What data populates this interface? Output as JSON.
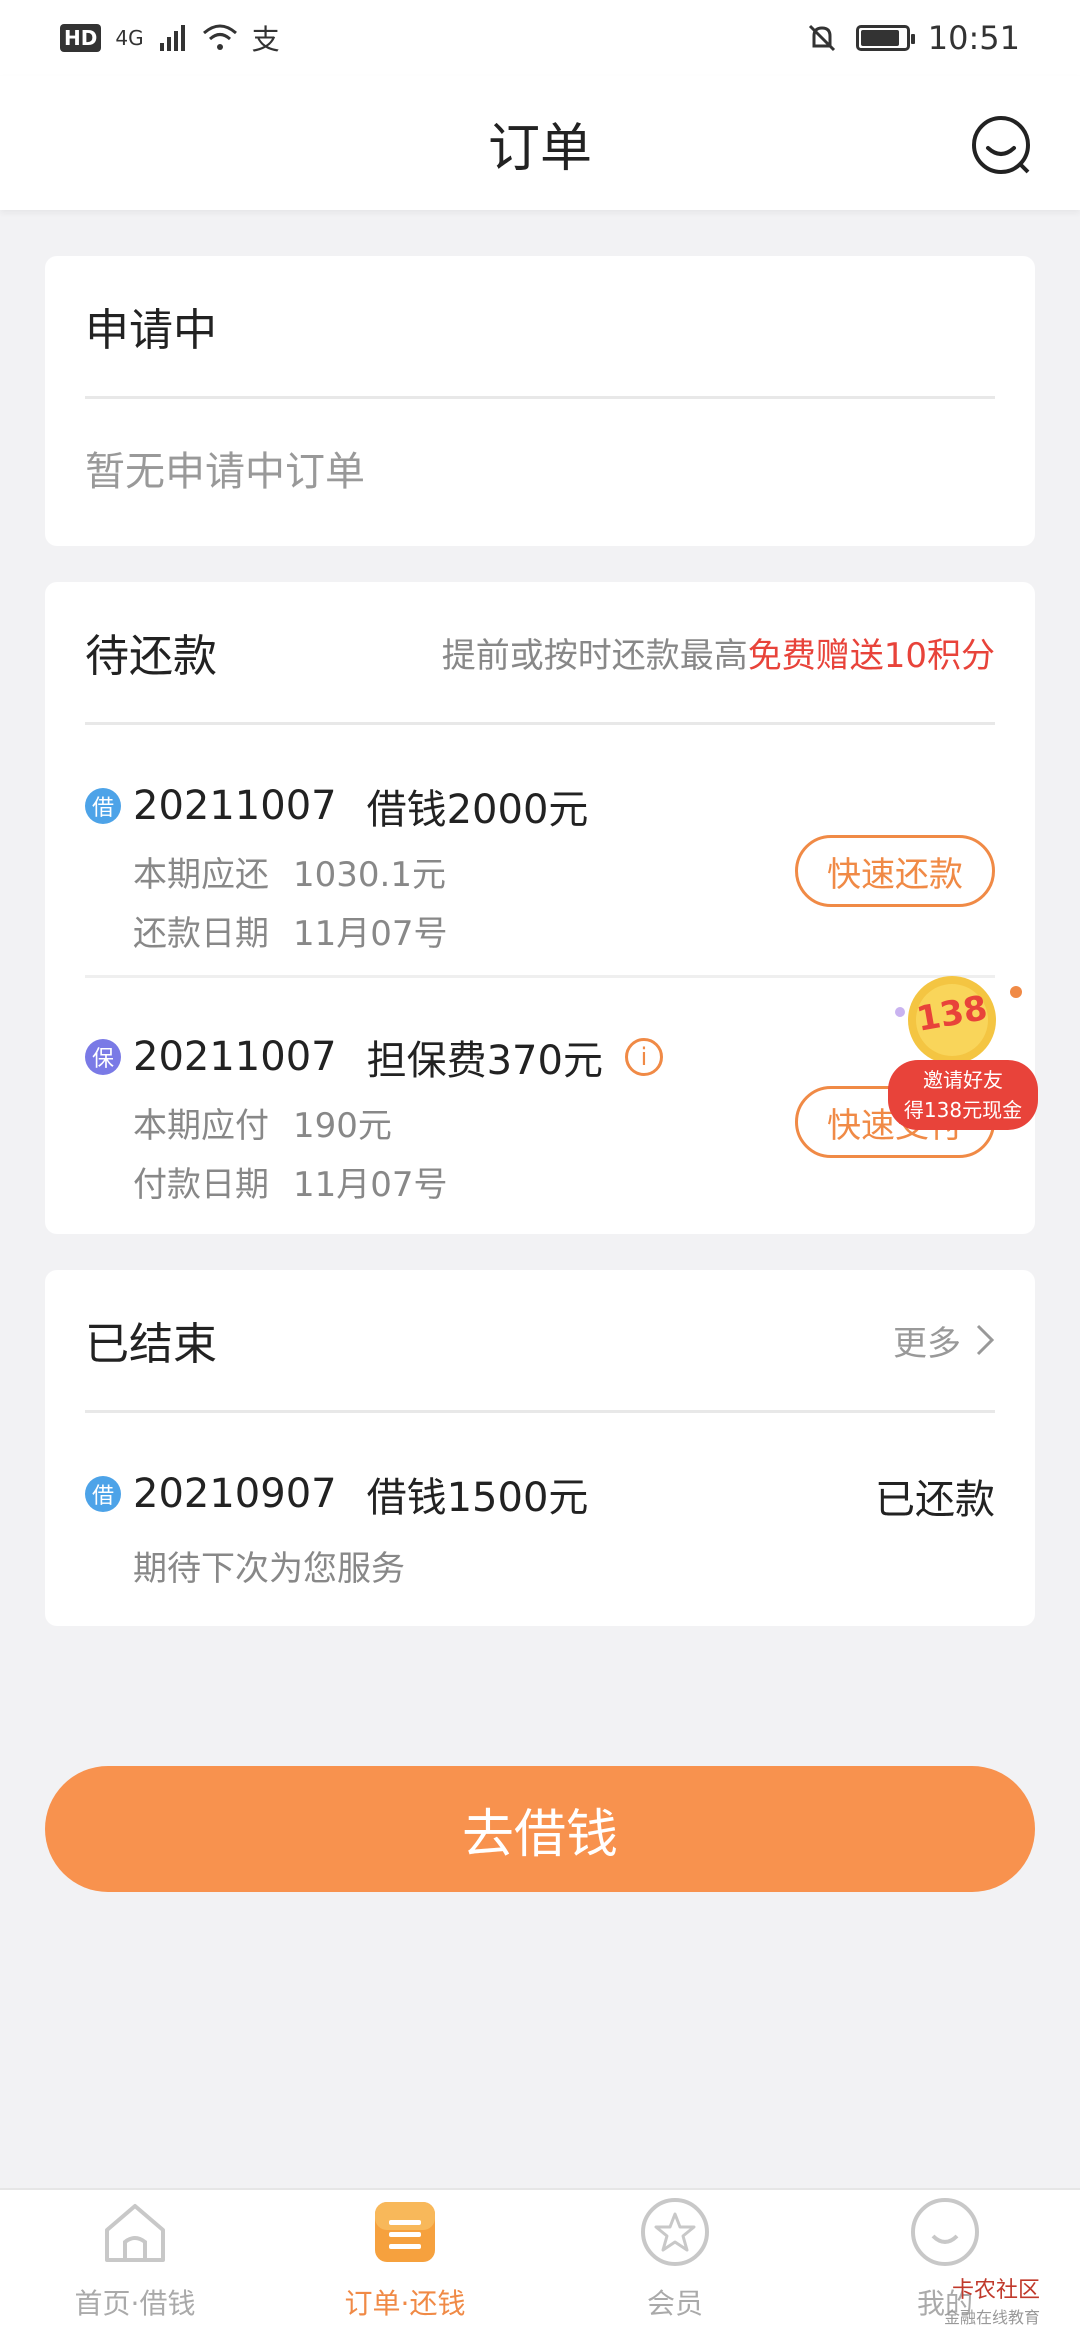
{
  "status_bar": {
    "hd": "HD",
    "network": "4G",
    "pay_icon": "支",
    "time": "10:51",
    "battery_level": 0.8
  },
  "header": {
    "title": "订单"
  },
  "applying": {
    "title": "申请中",
    "empty_text": "暂无申请中订单"
  },
  "pending": {
    "title": "待还款",
    "promo_text": "提前或按时还款最高",
    "promo_highlight": "免费赠送10积分",
    "items": [
      {
        "badge": "借",
        "id": "20211007",
        "name": "借钱2000元",
        "line1_label": "本期应还",
        "line1_value": "1030.1元",
        "line2_label": "还款日期",
        "line2_value": "11月07号",
        "button": "快速还款"
      },
      {
        "badge": "保",
        "id": "20211007",
        "name": "担保费370元",
        "line1_label": "本期应付",
        "line1_value": "190元",
        "line2_label": "付款日期",
        "line2_value": "11月07号",
        "button": "快速支付"
      }
    ]
  },
  "ad": {
    "amount": "138",
    "line1": "邀请好友",
    "line2": "得138元现金"
  },
  "finished": {
    "title": "已结束",
    "more": "更多",
    "item": {
      "badge": "借",
      "id": "20210907",
      "name": "借钱1500元",
      "status": "已还款",
      "note": "期待下次为您服务"
    }
  },
  "cta": {
    "label": "去借钱"
  },
  "tabbar": {
    "tabs": [
      {
        "label": "首页·借钱"
      },
      {
        "label": "订单·还钱"
      },
      {
        "label": "会员"
      },
      {
        "label": "我的"
      }
    ]
  },
  "watermark": {
    "line1": "卡农社区",
    "line2": "金融在线教育"
  },
  "colors": {
    "accent": "#f08a46",
    "cta": "#f8924e",
    "highlight": "#e8433a"
  }
}
